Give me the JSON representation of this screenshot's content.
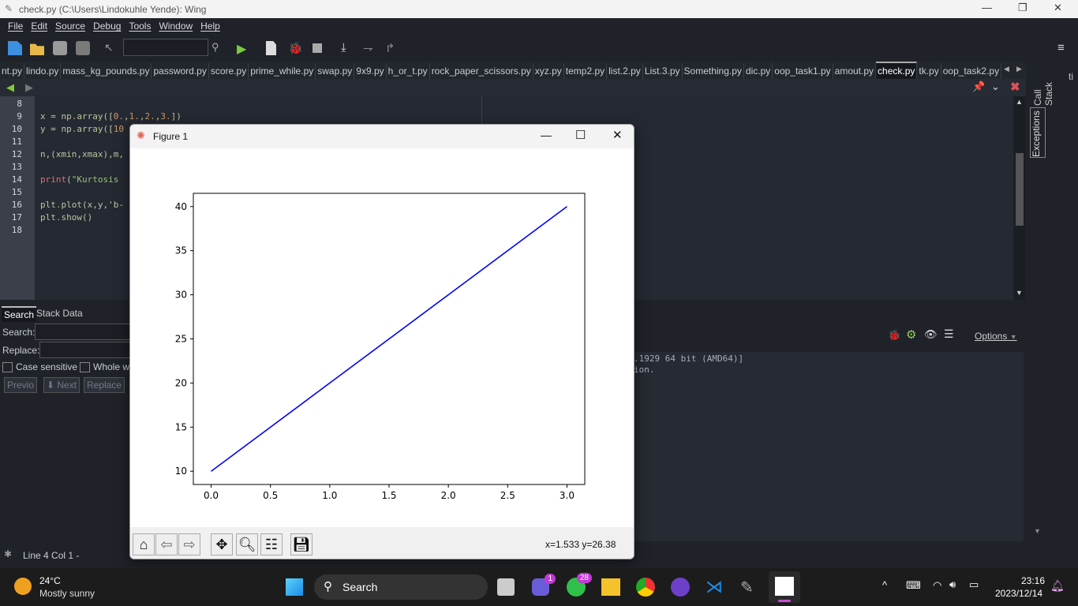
{
  "window": {
    "title": "check.py (C:\\Users\\Lindokuhle Yende): Wing"
  },
  "menu": [
    "File",
    "Edit",
    "Source",
    "Debug",
    "Tools",
    "Window",
    "Help"
  ],
  "toolbar": {
    "search_value": ""
  },
  "tabs": [
    "nt.py",
    "lindo.py",
    "mass_kg_pounds.py",
    "password.py",
    "score.py",
    "prime_while.py",
    "swap.py",
    "9x9.py",
    "h_or_t.py",
    "rock_paper_scissors.py",
    "xyz.py",
    "temp2.py",
    "list.2.py",
    "List.3.py",
    "Something.py",
    "dic.py",
    "oop_task1.py",
    "amout.py",
    "check.py",
    "tk.py",
    "oop_task2.py"
  ],
  "active_tab": "check.py",
  "editor": {
    "line_numbers": [
      "8",
      "9",
      "10",
      "11",
      "12",
      "13",
      "14",
      "15",
      "16",
      "17",
      "18"
    ],
    "lines": [
      "",
      "x = np.array([0.,1.,2.,3.])",
      "y = np.array([10",
      "",
      "n,(xmin,xmax),m,",
      "",
      "print(\"Kurtosis",
      "",
      "plt.plot(x,y,'b-",
      "plt.show()",
      ""
    ]
  },
  "side_tabs": {
    "call_stack": "Call Stack",
    "exceptions": "Exceptions",
    "partial": "ti"
  },
  "search_panel": {
    "tabs": [
      "Search",
      "Stack Data"
    ],
    "search_label": "Search:",
    "replace_label": "Replace:",
    "search_value": "",
    "replace_value": "",
    "case_sensitive": "Case sensitive",
    "whole_words": "Whole w",
    "previous": "Previo",
    "next": "Next",
    "replace": "Replace"
  },
  "shell": {
    "options": "Options",
    "lines": [
      ".1929 64 bit (AMD64)]",
      "ion."
    ]
  },
  "status": {
    "text": "Line 4 Col 1 -"
  },
  "figure": {
    "title": "Figure 1",
    "coords": "x=1.533 y=26.38"
  },
  "chart_data": {
    "type": "line",
    "x": [
      0,
      1,
      2,
      3
    ],
    "series": [
      {
        "values": [
          10,
          20,
          30,
          40
        ],
        "color": "#0000ff",
        "style": "b-"
      }
    ],
    "xlim": [
      -0.15,
      3.15
    ],
    "ylim": [
      8.5,
      41.5
    ],
    "xticks": [
      "0.0",
      "0.5",
      "1.0",
      "1.5",
      "2.0",
      "2.5",
      "3.0"
    ],
    "xtick_values": [
      0,
      0.5,
      1,
      1.5,
      2,
      2.5,
      3
    ],
    "yticks": [
      "10",
      "15",
      "20",
      "25",
      "30",
      "35",
      "40"
    ],
    "ytick_values": [
      10,
      15,
      20,
      25,
      30,
      35,
      40
    ],
    "grid": false,
    "title": "",
    "xlabel": "",
    "ylabel": ""
  },
  "taskbar": {
    "weather_temp": "24°C",
    "weather_desc": "Mostly sunny",
    "search": "Search",
    "teams_badge": "1",
    "whatsapp_badge": "28",
    "time": "23:16",
    "date": "2023/12/14"
  }
}
